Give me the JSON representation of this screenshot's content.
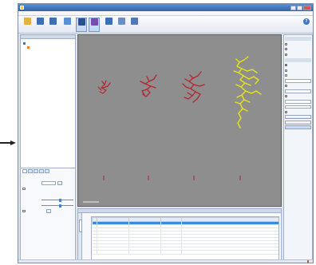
{
  "window": {
    "title": ""
  },
  "menu": [],
  "toolbar": {
    "tools": [],
    "help_label": ""
  },
  "left_panel": {
    "tree_items": [],
    "properties": {
      "rows": []
    }
  },
  "viewport": {
    "scale_label": "",
    "info_label": ""
  },
  "right_panel": {
    "rows": []
  },
  "bottom_panel": {
    "columns": [],
    "rows": []
  },
  "status": {
    "text": ""
  },
  "colors": {
    "titlebar": "#2e63ad",
    "viewport_bg": "#8e8e8e",
    "track_red": "#b3262e",
    "track_yellow": "#e8e21a",
    "selection": "#3c8be0"
  },
  "icons": [
    "help-icon",
    "app-icon",
    "minimize-icon",
    "maximize-icon",
    "close-icon",
    "arrow-icon",
    "folder-icon"
  ]
}
